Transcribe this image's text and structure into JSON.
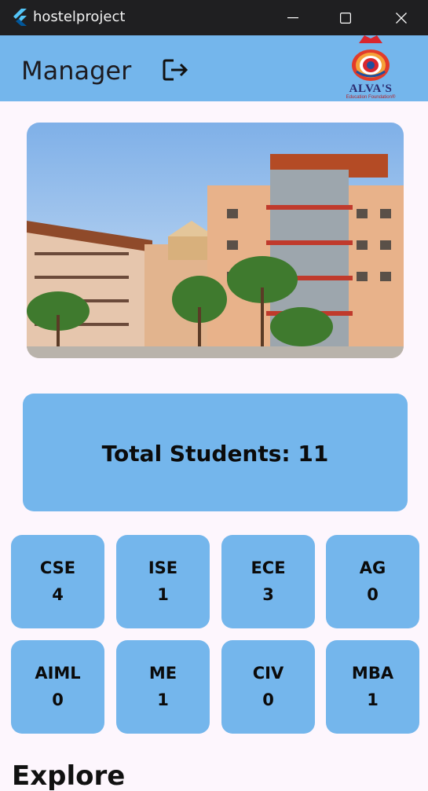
{
  "window": {
    "title": "hostelproject"
  },
  "appbar": {
    "title": "Manager",
    "logo_text": "ALVA'S",
    "logo_subtext": "Education Foundation®"
  },
  "summary": {
    "total_label": "Total Students: 11"
  },
  "departments": [
    {
      "name": "CSE",
      "count": "4"
    },
    {
      "name": "ISE",
      "count": "1"
    },
    {
      "name": "ECE",
      "count": "3"
    },
    {
      "name": "AG",
      "count": "0"
    },
    {
      "name": "AIML",
      "count": "0"
    },
    {
      "name": "ME",
      "count": "1"
    },
    {
      "name": "CIV",
      "count": "0"
    },
    {
      "name": "MBA",
      "count": "1"
    }
  ],
  "section": {
    "explore_title": "Explore"
  },
  "colors": {
    "accent": "#74b6ec",
    "background": "#fdf6fd",
    "titlebar": "#1f1f21"
  }
}
